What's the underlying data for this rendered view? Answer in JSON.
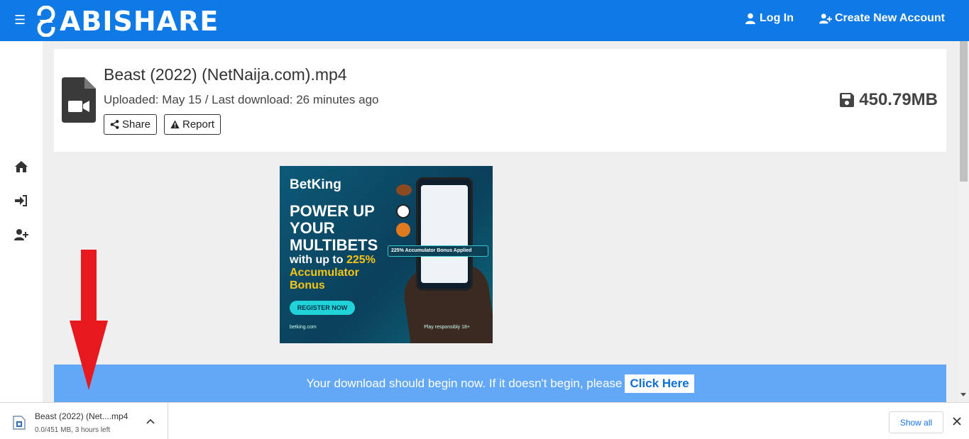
{
  "header": {
    "logo_text": "ABISHARE",
    "login_label": "Log In",
    "create_account_label": "Create New Account",
    "bg_color": "#0f7ae5"
  },
  "sidebar": {
    "icons": [
      "home-icon",
      "sign-in-icon",
      "user-plus-icon"
    ]
  },
  "file": {
    "title": "Beast (2022) (NetNaija.com).mp4",
    "meta": "Uploaded: May 15 / Last download: 26 minutes ago",
    "share_label": "Share",
    "report_label": "Report",
    "size": "450.79MB"
  },
  "ad": {
    "brand": "BetKing",
    "headline": "POWER UP YOUR MULTIBETS",
    "sub_prefix": "with up to",
    "sub_highlight": "225%",
    "sub_highlight2": "Accumulator Bonus",
    "cta": "REGISTER NOW",
    "url": "betking.com",
    "responsible": "Play responsibly 18+",
    "pill": "225% Accumulator Bonus Applied"
  },
  "notice": {
    "text": "Your download should begin now. If it doesn't begin, please",
    "click_label": "Click Here",
    "bg_color": "#63a8f6"
  },
  "download_bar": {
    "filename": "Beast (2022) (Net....mp4",
    "status": "0.0/451 MB, 3 hours left",
    "show_all_label": "Show all"
  }
}
